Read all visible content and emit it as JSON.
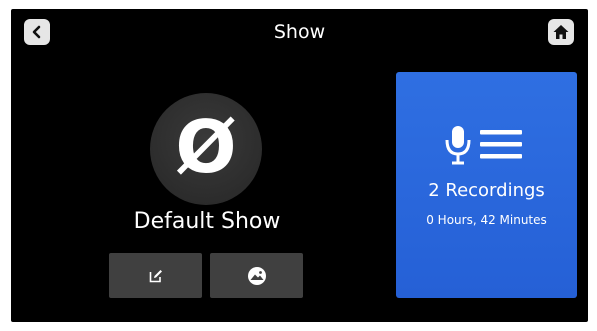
{
  "header": {
    "title": "Show",
    "back_icon": "chevron-left-icon",
    "home_icon": "home-icon"
  },
  "show": {
    "logo_glyph": "Ø",
    "name": "Default Show",
    "actions": [
      {
        "name": "edit",
        "icon": "edit-icon"
      },
      {
        "name": "change-image",
        "icon": "image-icon"
      }
    ]
  },
  "recordings": {
    "icon": "microphone-list-icon",
    "count_label": "2 Recordings",
    "duration_label": "0 Hours, 42 Minutes"
  },
  "colors": {
    "screen_background": "#000000",
    "card_accent": "#2a66dc",
    "button_background": "#404040",
    "icon_button_background": "#e6e6e6"
  }
}
